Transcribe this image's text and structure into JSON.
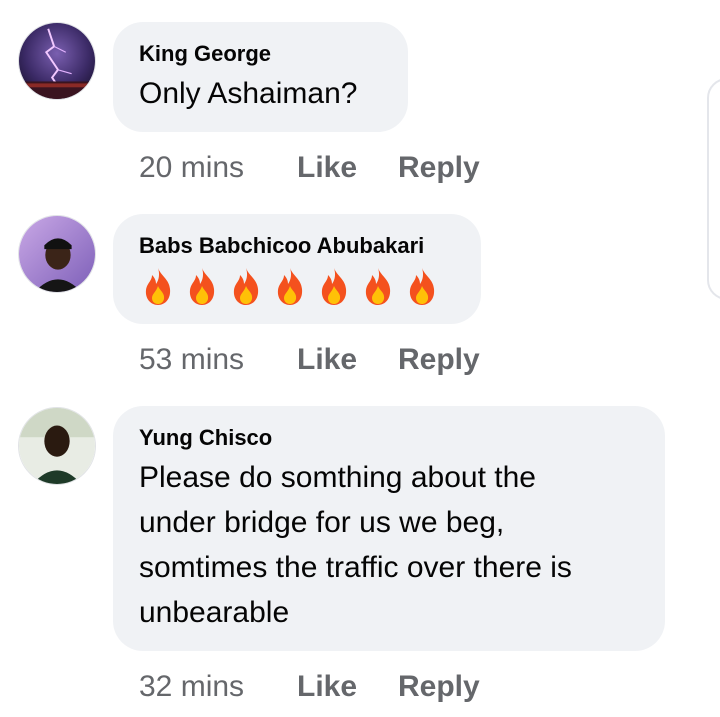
{
  "comments": [
    {
      "author": "King George",
      "text": "Only Ashaiman?",
      "avatar": "storm-lightning-avatar",
      "time": "20 mins",
      "like_label": "Like",
      "reply_label": "Reply"
    },
    {
      "author": "Babs Babchicoo Abubakari",
      "reaction_emoji": [
        "🔥",
        "🔥",
        "🔥",
        "🔥",
        "🔥",
        "🔥",
        "🔥"
      ],
      "avatar": "person-in-cap-avatar",
      "time": "53 mins",
      "like_label": "Like",
      "reply_label": "Reply"
    },
    {
      "author": "Yung Chisco",
      "text_lines": [
        "Please do somthing about the",
        "under bridge for us we beg,",
        "somtimes the traffic over there is",
        "unbearable"
      ],
      "avatar": "person-portrait-avatar",
      "time": "32 mins",
      "like_label": "Like",
      "reply_label": "Reply"
    }
  ],
  "colors": {
    "bubble": "#f0f2f5",
    "name_text": "#050505",
    "meta_text": "#65676b",
    "fire_outer": "#f4511e",
    "fire_inner": "#ffc107"
  }
}
